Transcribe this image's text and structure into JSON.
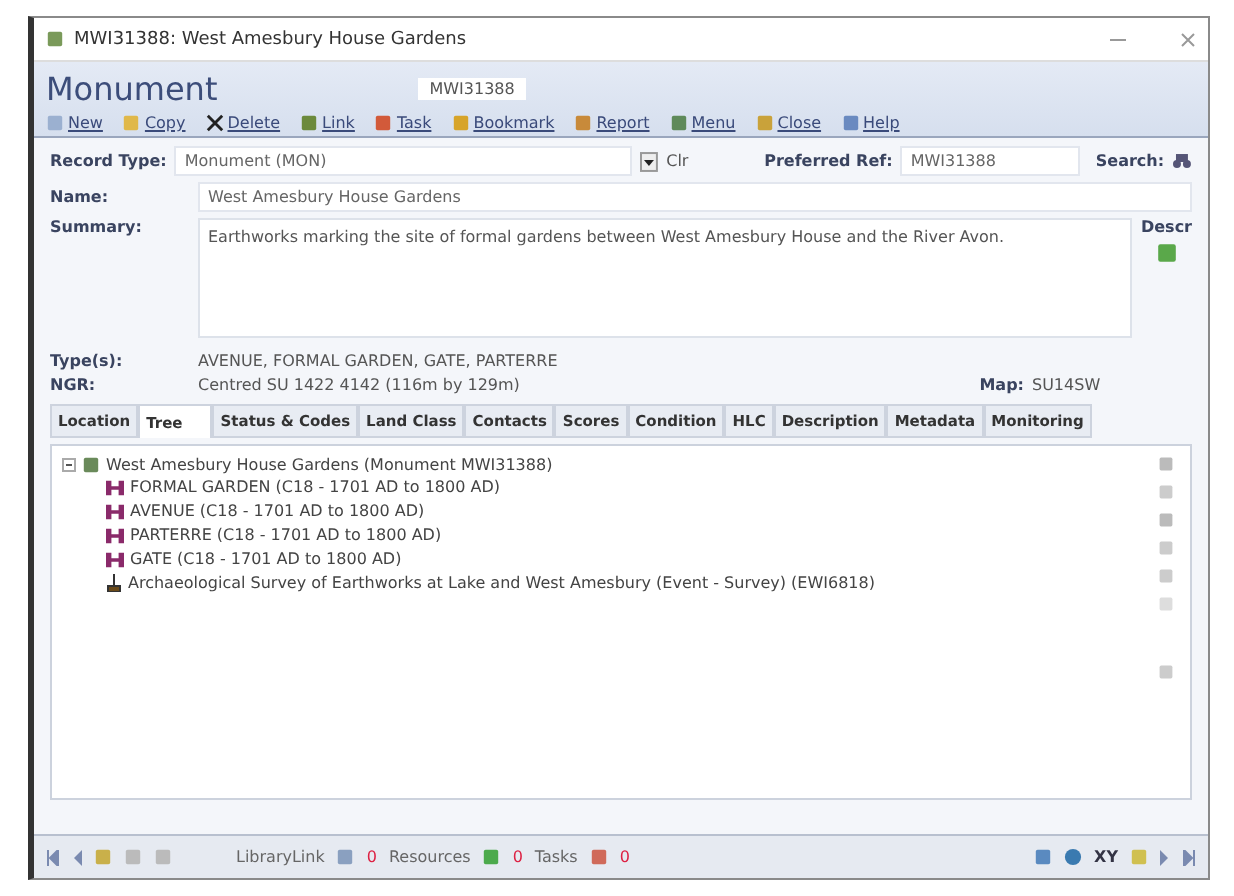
{
  "window": {
    "title": "MWI31388: West Amesbury House Gardens"
  },
  "header": {
    "title": "Monument",
    "ref": "MWI31388"
  },
  "toolbar": [
    {
      "label": "New",
      "kind": "new"
    },
    {
      "label": "Copy",
      "kind": "copy"
    },
    {
      "label": "Delete",
      "kind": "delete"
    },
    {
      "label": "Link",
      "kind": "link"
    },
    {
      "label": "Task",
      "kind": "task"
    },
    {
      "label": "Bookmark",
      "kind": "bookmark"
    },
    {
      "label": "Report",
      "kind": "report"
    },
    {
      "label": "Menu",
      "kind": "menu"
    },
    {
      "label": "Close",
      "kind": "close"
    },
    {
      "label": "Help",
      "kind": "help"
    }
  ],
  "record_type": {
    "label": "Record Type:",
    "value": "Monument (MON)",
    "clear": "Clr"
  },
  "preferred_ref": {
    "label": "Preferred Ref:",
    "value": "MWI31388"
  },
  "search": {
    "label": "Search:"
  },
  "name": {
    "label": "Name:",
    "value": "West Amesbury House Gardens"
  },
  "summary": {
    "label": "Summary:",
    "value": "Earthworks marking the site of formal gardens between West Amesbury House and the River Avon.",
    "side_label": "Descr"
  },
  "types": {
    "label": "Type(s):",
    "value": "AVENUE, FORMAL GARDEN, GATE, PARTERRE"
  },
  "ngr": {
    "label": "NGR:",
    "value": "Centred SU 1422 4142 (116m by 129m)"
  },
  "map": {
    "label": "Map:",
    "value": "SU14SW"
  },
  "tabs": [
    {
      "label": "Location",
      "selected": false
    },
    {
      "label": "Tree",
      "selected": true
    },
    {
      "label": "Status & Codes",
      "selected": false
    },
    {
      "label": "Land Class",
      "selected": false
    },
    {
      "label": "Contacts",
      "selected": false
    },
    {
      "label": "Scores",
      "selected": false
    },
    {
      "label": "Condition",
      "selected": false
    },
    {
      "label": "HLC",
      "selected": false
    },
    {
      "label": "Description",
      "selected": false
    },
    {
      "label": "Metadata",
      "selected": false
    },
    {
      "label": "Monitoring",
      "selected": false
    }
  ],
  "tree": {
    "label": "West Amesbury House Gardens (Monument MWI31388)",
    "expanded": true,
    "children": [
      {
        "label": "FORMAL GARDEN (C18 - 1701 AD to 1800 AD)",
        "kind": "component"
      },
      {
        "label": "AVENUE (C18 - 1701 AD to 1800 AD)",
        "kind": "component"
      },
      {
        "label": "PARTERRE (C18 - 1701 AD to 1800 AD)",
        "kind": "component"
      },
      {
        "label": "GATE (C18 - 1701 AD to 1800 AD)",
        "kind": "component"
      },
      {
        "label": "Archaeological Survey of Earthworks at Lake and West Amesbury (Event - Survey) (EWI6818)",
        "kind": "event"
      }
    ]
  },
  "status_bar": {
    "counters": [
      {
        "label": "LibraryLink",
        "count": "0",
        "kind": "library"
      },
      {
        "label": "Resources",
        "count": "0",
        "kind": "resources"
      },
      {
        "label": "Tasks",
        "count": "0",
        "kind": "tasks"
      }
    ],
    "xy": "XY"
  }
}
